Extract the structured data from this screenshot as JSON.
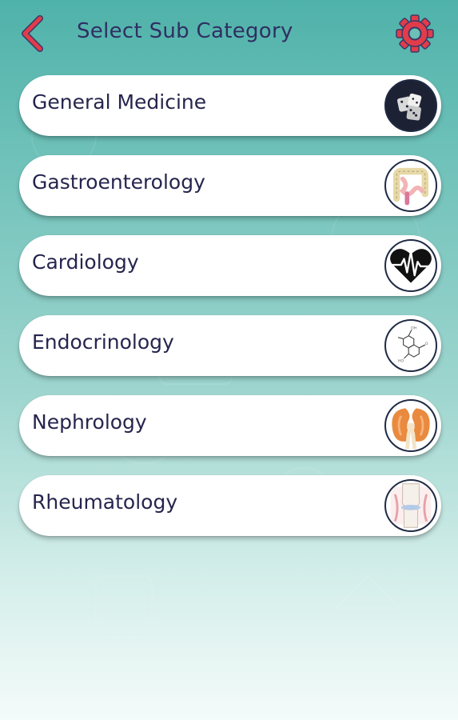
{
  "header": {
    "title": "Select Sub Category",
    "back_icon": "chevron-left-icon",
    "settings_icon": "gear-icon"
  },
  "colors": {
    "accent": "#e23c4b",
    "title_text": "#2f2f62",
    "item_text": "#25254e",
    "background_top": "#4fb2aa",
    "background_bottom": "#f4fbfa"
  },
  "categories": [
    {
      "label": "General Medicine",
      "icon": "dice-icon"
    },
    {
      "label": "Gastroenterology",
      "icon": "intestine-icon"
    },
    {
      "label": "Cardiology",
      "icon": "heartbeat-icon"
    },
    {
      "label": "Endocrinology",
      "icon": "molecule-icon"
    },
    {
      "label": "Nephrology",
      "icon": "kidney-icon"
    },
    {
      "label": "Rheumatology",
      "icon": "knee-joint-icon"
    }
  ]
}
